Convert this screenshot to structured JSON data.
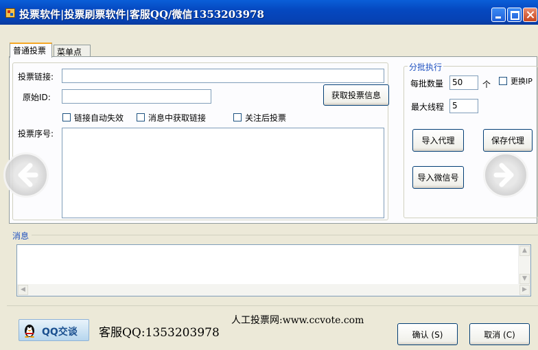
{
  "window": {
    "title": "投票软件|投票刷票软件|客服QQ/微信1353203978"
  },
  "tabs": [
    {
      "label": "普通投票"
    },
    {
      "label": "菜单点击"
    }
  ],
  "form": {
    "vote_link_label": "投票链接:",
    "vote_link_value": "",
    "original_id_label": "原始ID:",
    "original_id_value": "",
    "fetch_button": "获取投票信息",
    "checkbox_auto_expire": "链接自动失效",
    "checkbox_get_link_msg": "消息中获取链接",
    "checkbox_follow_vote": "关注后投票",
    "vote_seq_label": "投票序号:"
  },
  "batch": {
    "group_title": "分批执行",
    "per_batch_label": "每批数量",
    "per_batch_value": "50",
    "unit": "个",
    "change_ip_label": "更换IP",
    "max_threads_label": "最大线程",
    "max_threads_value": "5",
    "import_proxy": "导入代理",
    "save_proxy": "保存代理",
    "import_wechat": "导入微信号"
  },
  "messages": {
    "label": "消息"
  },
  "footer": {
    "qq_button": "QQ交谈",
    "support_qq": "客服QQ:1353203978",
    "website": "人工投票网:www.ccvote.com",
    "confirm": "确认 (S)",
    "cancel": "取消 (C)"
  },
  "colors": {
    "titlebar": "#0548c0",
    "window_bg": "#ece9d8",
    "group_title": "#1c4fbf"
  }
}
